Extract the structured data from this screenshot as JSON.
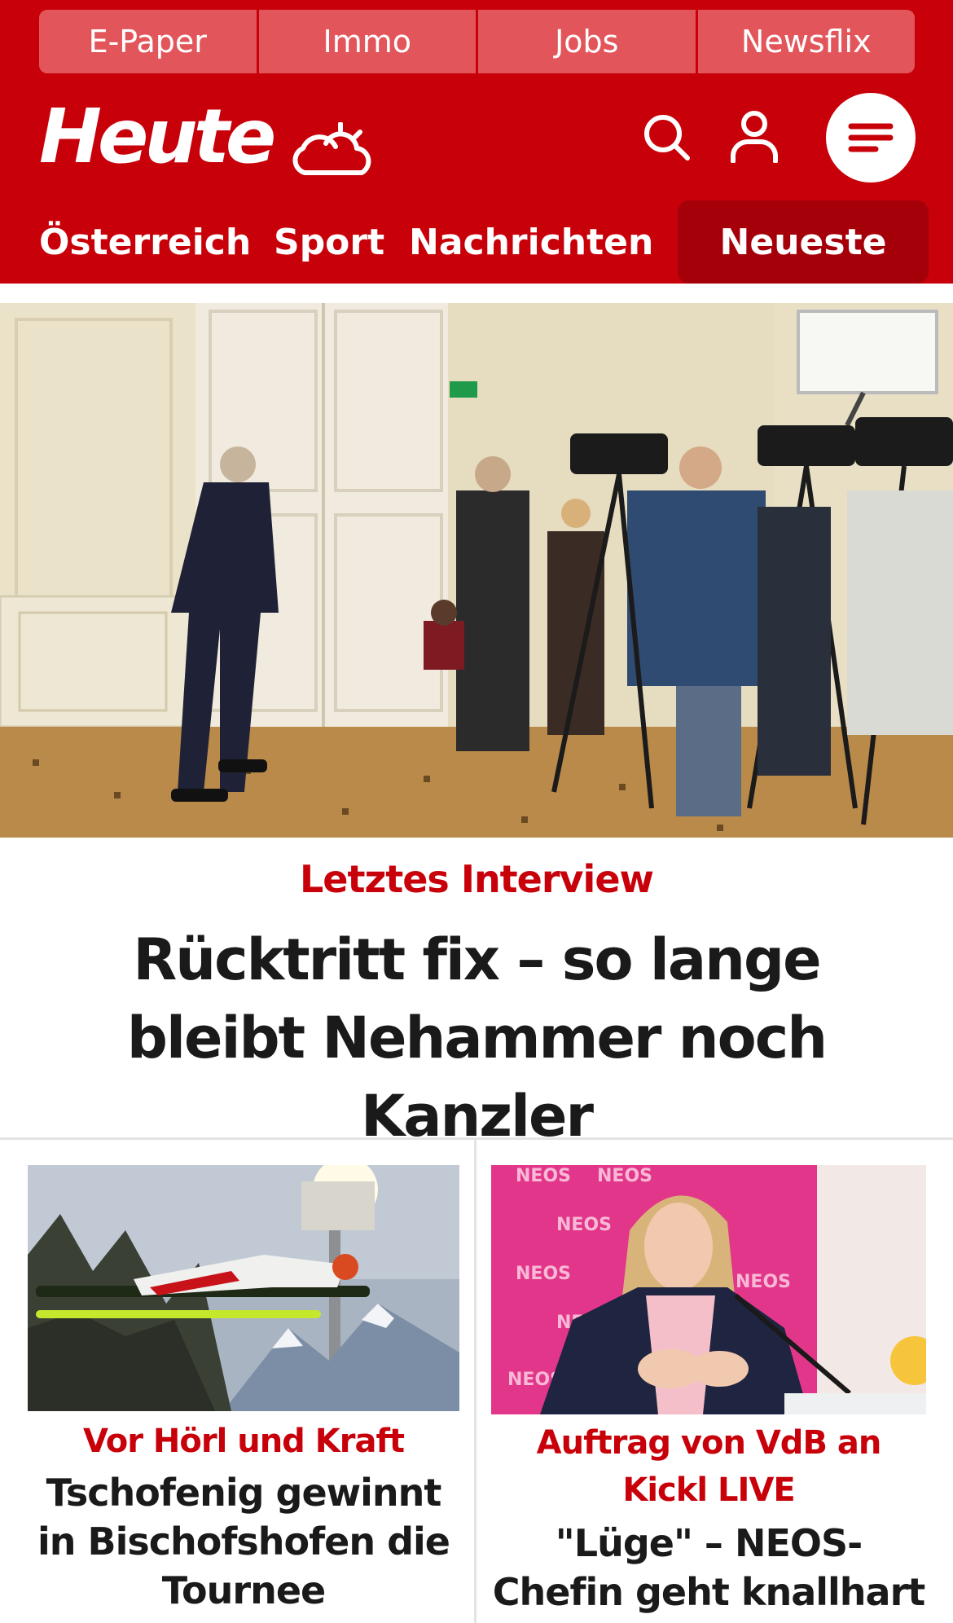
{
  "topnav": {
    "items": [
      {
        "label": "E-Paper"
      },
      {
        "label": "Immo"
      },
      {
        "label": "Jobs"
      },
      {
        "label": "Newsflix"
      }
    ]
  },
  "brand": {
    "logo_text": "Heute",
    "weather_icon": "cloud-sun-icon",
    "search_icon": "search-icon",
    "user_icon": "user-icon",
    "menu_icon": "hamburger-menu-icon"
  },
  "sections": {
    "items": [
      {
        "label": "Österreich"
      },
      {
        "label": "Sport"
      },
      {
        "label": "Nachrichten"
      },
      {
        "label": "Neueste"
      }
    ],
    "active": "Neueste"
  },
  "hero": {
    "kicker": "Letztes Interview",
    "title": "Rücktritt fix – so lange bleibt Nehammer noch Kanzler"
  },
  "teasers": [
    {
      "kicker": "Vor Hörl und Kraft",
      "title": "Tschofenig gewinnt in Bischofshofen die Tournee"
    },
    {
      "kicker": "Auftrag von VdB an Kickl LIVE",
      "title": "\"Lüge\" – NEOS-Chefin geht knallhart auf"
    }
  ],
  "colors": {
    "brand_red": "#c8000a",
    "topnav_bg": "#e2565b",
    "active_tab_bg": "#a5000a",
    "divider": "#e3e3e3"
  }
}
